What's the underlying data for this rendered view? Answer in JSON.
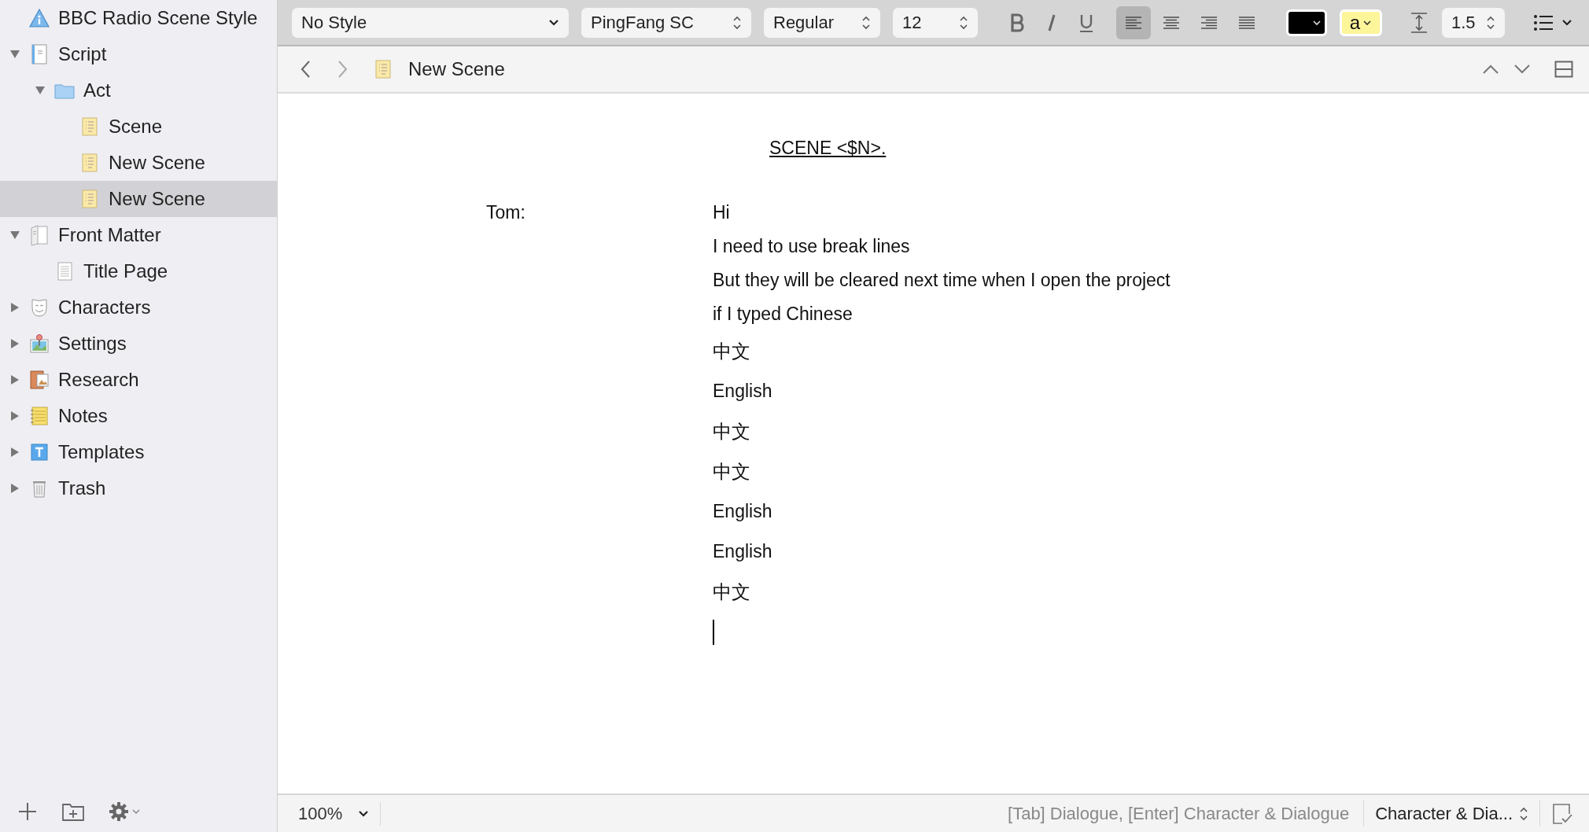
{
  "binder": [
    {
      "kind": "info",
      "label": "BBC Radio Scene Style",
      "selected": false
    },
    {
      "kind": "script",
      "label": "Script",
      "expanded": true,
      "selected": false,
      "children": [
        {
          "kind": "folder",
          "label": "Act",
          "expanded": true,
          "selected": false,
          "children": [
            {
              "kind": "scene",
              "label": "Scene",
              "selected": false
            },
            {
              "kind": "scene",
              "label": "New Scene",
              "selected": false
            },
            {
              "kind": "scene",
              "label": "New Scene",
              "selected": true
            }
          ]
        }
      ]
    },
    {
      "kind": "frontmatter",
      "label": "Front Matter",
      "expanded": true,
      "selected": false,
      "children": [
        {
          "kind": "page",
          "label": "Title Page",
          "selected": false
        }
      ]
    },
    {
      "kind": "characters",
      "label": "Characters",
      "expanded": false,
      "selected": false
    },
    {
      "kind": "settings",
      "label": "Settings",
      "expanded": false,
      "selected": false
    },
    {
      "kind": "research",
      "label": "Research",
      "expanded": false,
      "selected": false
    },
    {
      "kind": "notes",
      "label": "Notes",
      "expanded": false,
      "selected": false
    },
    {
      "kind": "templates",
      "label": "Templates",
      "expanded": false,
      "selected": false
    },
    {
      "kind": "trash",
      "label": "Trash",
      "expanded": false,
      "selected": false
    }
  ],
  "toolbar": {
    "style": "No Style",
    "font": "PingFang SC",
    "weight": "Regular",
    "size": "12",
    "format": [
      {
        "kind": "bold"
      },
      {
        "kind": "italic"
      },
      {
        "kind": "underline"
      }
    ],
    "alignment": [
      {
        "kind": "left",
        "selected": true
      },
      {
        "kind": "center",
        "selected": false
      },
      {
        "kind": "right",
        "selected": false
      },
      {
        "kind": "justify",
        "selected": false
      }
    ],
    "highlight": {
      "label": "a"
    },
    "line_spacing": "1.5"
  },
  "header": {
    "title": "New Scene"
  },
  "editor": {
    "heading": "SCENE <$N>.",
    "character": "Tom:",
    "lines": [
      {
        "text": "Hi",
        "kind": "latin"
      },
      {
        "text": "I need to use break lines",
        "kind": "latin"
      },
      {
        "text": "But they will be cleared next time when I open the project",
        "kind": "latin"
      },
      {
        "text": "if I typed Chinese",
        "kind": "latin"
      },
      {
        "text": "中文",
        "kind": "cjk"
      },
      {
        "text": "English",
        "kind": "latin"
      },
      {
        "text": "中文",
        "kind": "cjk"
      },
      {
        "text": "中文",
        "kind": "cjk"
      },
      {
        "text": "English",
        "kind": "latin"
      },
      {
        "text": "English",
        "kind": "latin"
      },
      {
        "text": "中文",
        "kind": "cjk"
      }
    ]
  },
  "status_bar": {
    "zoom": "100%",
    "hint": "[Tab] Dialogue, [Enter] Character & Dialogue",
    "element_style": "Character & Dia..."
  }
}
